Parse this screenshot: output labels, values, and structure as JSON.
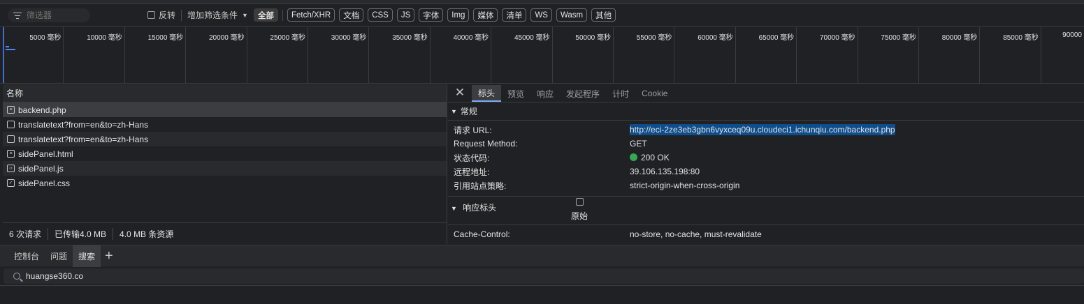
{
  "filter": {
    "placeholder": "筛选器",
    "invert_label": "反转",
    "more_filters_label": "增加筛选条件",
    "chips": [
      "全部",
      "Fetch/XHR",
      "文档",
      "CSS",
      "JS",
      "字体",
      "Img",
      "媒体",
      "清单",
      "WS",
      "Wasm",
      "其他"
    ],
    "active_chip": "全部"
  },
  "timeline": {
    "ticks": [
      "5000 毫秒",
      "10000 毫秒",
      "15000 毫秒",
      "20000 毫秒",
      "25000 毫秒",
      "30000 毫秒",
      "35000 毫秒",
      "40000 毫秒",
      "45000 毫秒",
      "50000 毫秒",
      "55000 毫秒",
      "60000 毫秒",
      "65000 毫秒",
      "70000 毫秒",
      "75000 毫秒",
      "80000 毫秒",
      "85000 毫秒",
      "90000"
    ]
  },
  "requests": {
    "header": "名称",
    "items": [
      {
        "name": "backend.php",
        "icon": "document-icon"
      },
      {
        "name": "translatetext?from=en&to=zh-Hans",
        "icon": "xhr-icon"
      },
      {
        "name": "translatetext?from=en&to=zh-Hans",
        "icon": "file-icon"
      },
      {
        "name": "sidePanel.html",
        "icon": "document-icon"
      },
      {
        "name": "sidePanel.js",
        "icon": "script-icon"
      },
      {
        "name": "sidePanel.css",
        "icon": "stylesheet-icon"
      }
    ],
    "status": {
      "count": "6 次请求",
      "transferred": "已传输4.0 MB",
      "resources": "4.0 MB 条资源"
    }
  },
  "details": {
    "tabs": [
      "标头",
      "预览",
      "响应",
      "发起程序",
      "计时",
      "Cookie"
    ],
    "active_tab": "标头",
    "general_title": "常规",
    "general": [
      {
        "key": "请求 URL:",
        "value": "http://eci-2ze3eb3gbn6vyxceq09u.cloudeci1.ichunqiu.com/backend.php"
      },
      {
        "key": "Request Method:",
        "value": "GET"
      },
      {
        "key": "状态代码:",
        "value": "200 OK"
      },
      {
        "key": "远程地址:",
        "value": "39.106.135.198:80"
      },
      {
        "key": "引用站点策略:",
        "value": "strict-origin-when-cross-origin"
      }
    ],
    "response_headers_title": "响应标头",
    "raw_label": "原始",
    "response_headers": [
      {
        "key": "Cache-Control:",
        "value": "no-store, no-cache, must-revalidate"
      }
    ]
  },
  "drawer": {
    "tabs": [
      "控制台",
      "问题",
      "搜索"
    ],
    "active_tab": "搜索",
    "search_value": "huangse360.co"
  },
  "colors": {
    "background": "#202124",
    "status_ok": "#34a853",
    "url_highlight": "#0f4d8a",
    "accent": "#7cacf8"
  }
}
